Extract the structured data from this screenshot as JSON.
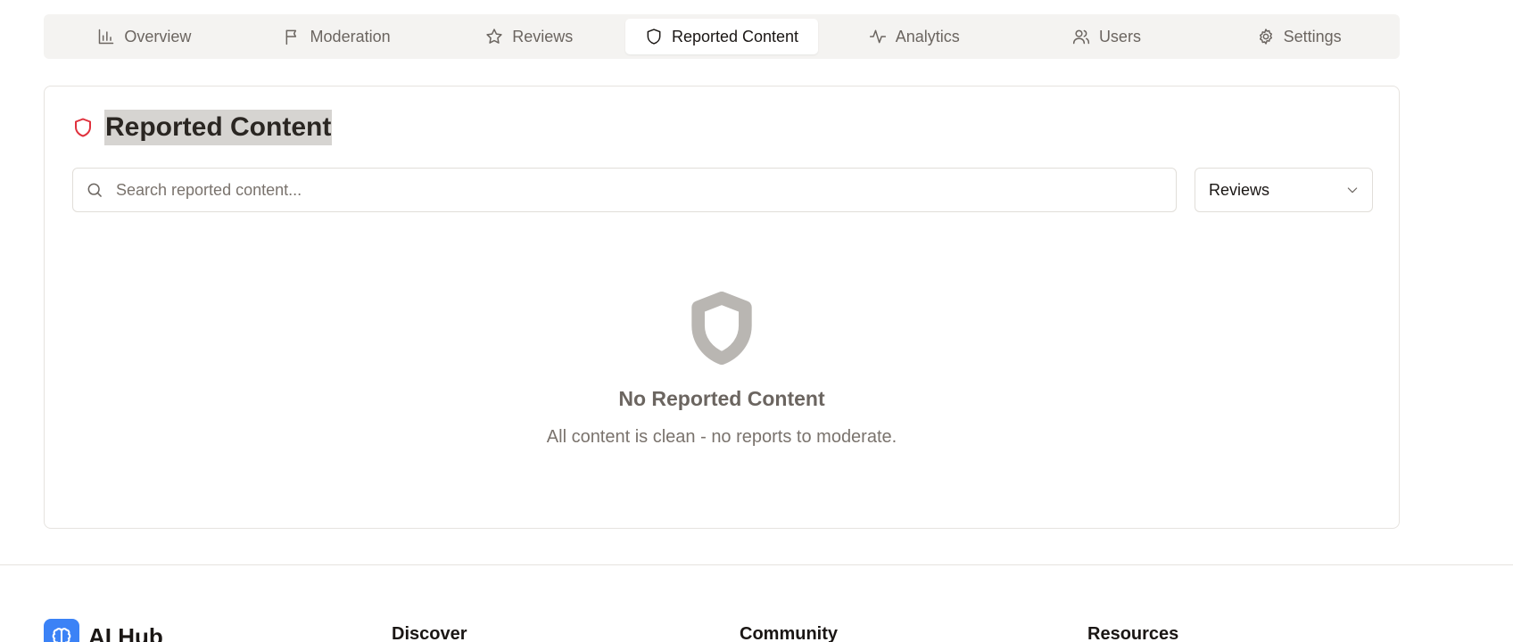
{
  "tabs": [
    {
      "label": "Overview",
      "icon": "bar-chart-icon"
    },
    {
      "label": "Moderation",
      "icon": "flag-icon"
    },
    {
      "label": "Reviews",
      "icon": "star-icon"
    },
    {
      "label": "Reported Content",
      "icon": "shield-icon",
      "active": true
    },
    {
      "label": "Analytics",
      "icon": "activity-icon"
    },
    {
      "label": "Users",
      "icon": "users-icon"
    },
    {
      "label": "Settings",
      "icon": "gear-icon"
    }
  ],
  "card": {
    "title": "Reported Content",
    "title_icon": "shield-icon",
    "title_icon_color": "#e0313d",
    "search": {
      "placeholder": "Search reported content...",
      "value": ""
    },
    "filter": {
      "selected": "Reviews"
    },
    "empty": {
      "icon": "shield-icon",
      "heading": "No Reported Content",
      "message": "All content is clean - no reports to moderate."
    }
  },
  "footer": {
    "brand": "AI Hub",
    "brand_color": "#3b82f6",
    "columns": [
      "Discover",
      "Community",
      "Resources"
    ]
  }
}
